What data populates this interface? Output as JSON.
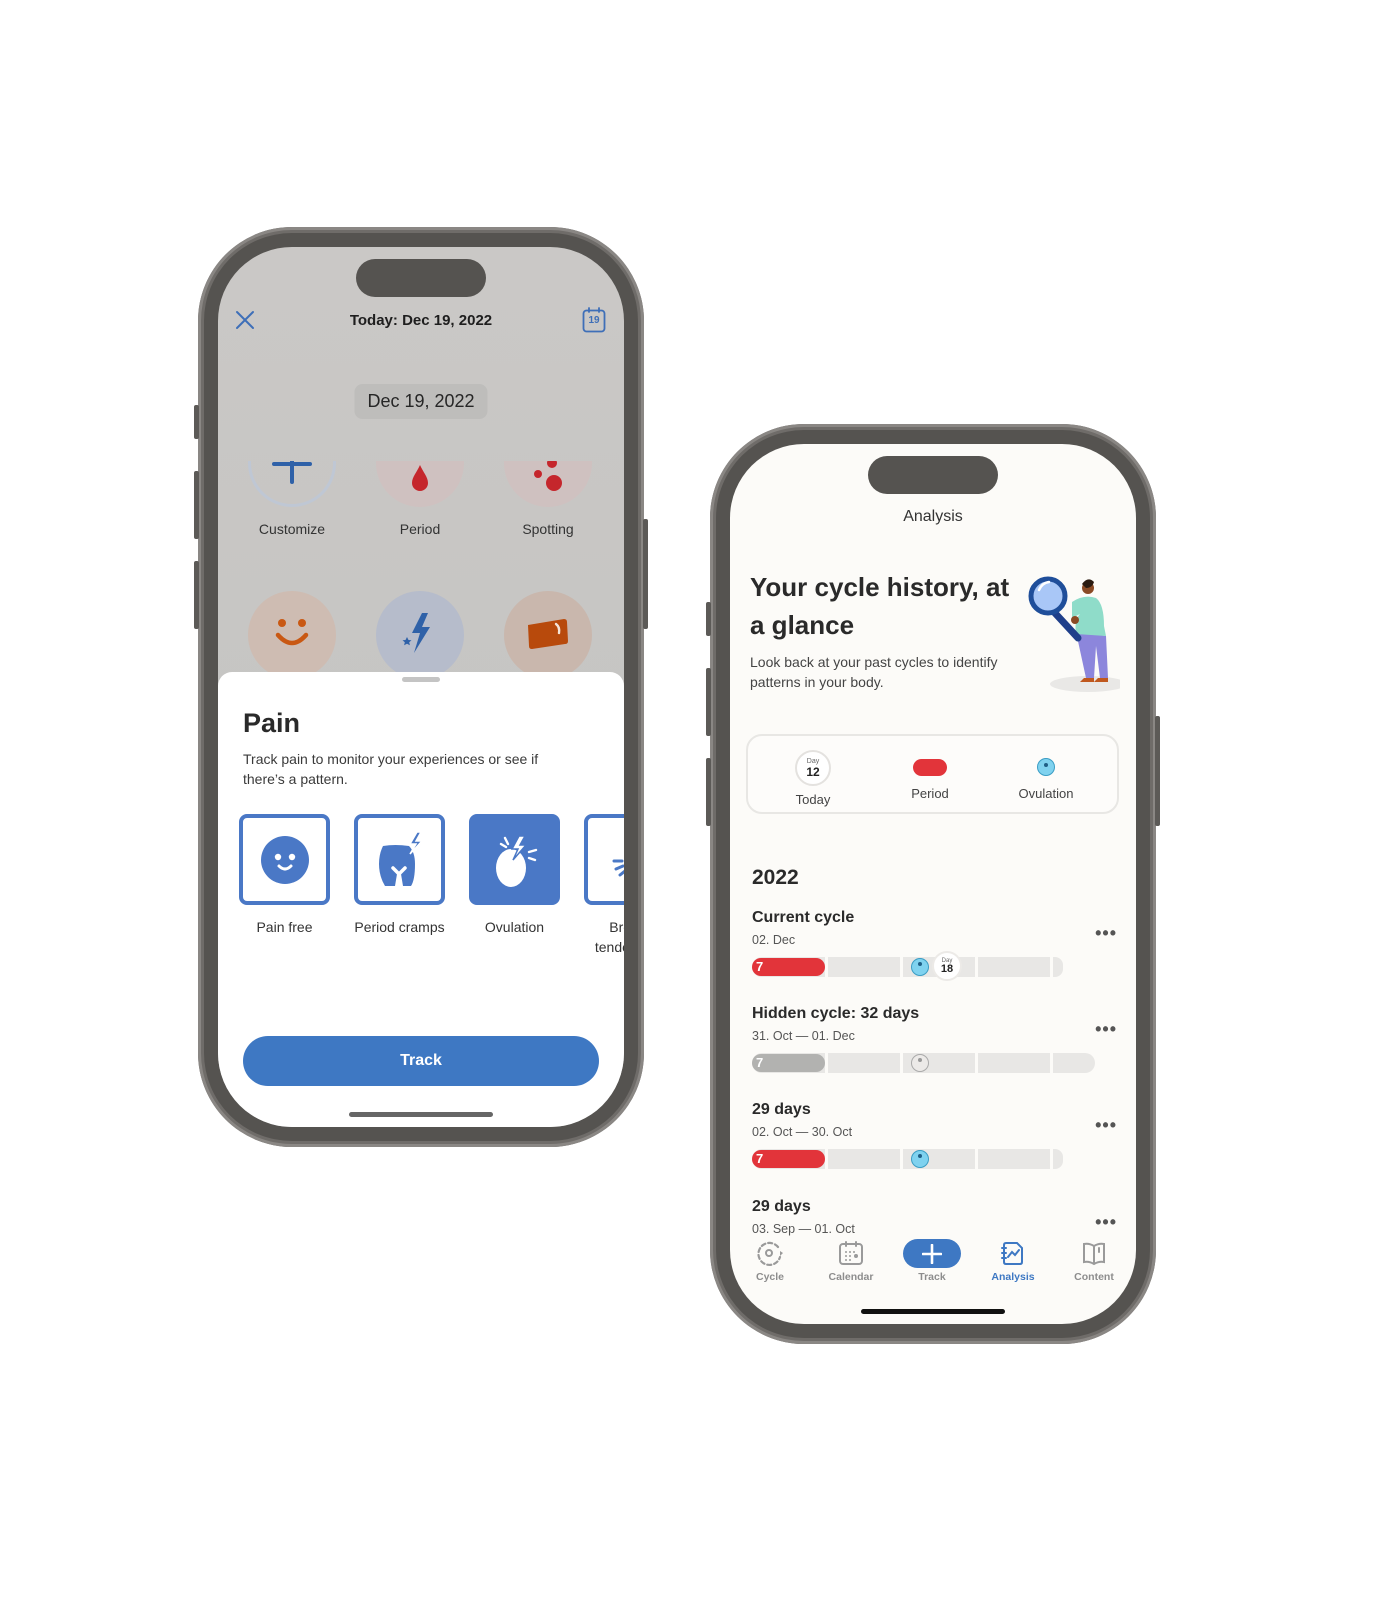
{
  "left_phone": {
    "header": {
      "title": "Today: Dec 19, 2022",
      "calendar_day": "19",
      "close_icon": "close-icon",
      "calendar_icon": "calendar-icon"
    },
    "date_pill": "Dec 19, 2022",
    "categories": [
      {
        "label": "Customize",
        "icon": "plus-icon"
      },
      {
        "label": "Period",
        "icon": "blood-drop-icon"
      },
      {
        "label": "Spotting",
        "icon": "spotting-dots-icon"
      },
      {
        "label": "",
        "icon": "smiley-face-icon"
      },
      {
        "label": "",
        "icon": "lightning-icon"
      },
      {
        "label": "",
        "icon": "pad-icon"
      }
    ],
    "sheet": {
      "title": "Pain",
      "description": "Track pain to monitor your experiences or see if there’s a pattern.",
      "options": [
        {
          "label": "Pain free",
          "icon": "smiley-face-icon",
          "selected": false
        },
        {
          "label": "Period cramps",
          "icon": "cramps-icon",
          "selected": false
        },
        {
          "label": "Ovulation",
          "icon": "ovulation-pain-icon",
          "selected": true
        },
        {
          "label": "Breast tenderness",
          "label_visible": "Br\ntend",
          "icon": "breast-tenderness-icon",
          "selected": false
        }
      ],
      "track_button": "Track"
    }
  },
  "right_phone": {
    "nav_title": "Analysis",
    "hero": {
      "title": "Your cycle history, at a glance",
      "description": "Look back at your past cycles to identify patterns in your body."
    },
    "legend": {
      "today": {
        "day_label": "Day",
        "day_number": "12",
        "label": "Today"
      },
      "period": {
        "label": "Period"
      },
      "ovulation": {
        "label": "Ovulation"
      }
    },
    "year": "2022",
    "cycles": [
      {
        "title": "Current cycle",
        "dates": "02. Dec",
        "period_days": "7",
        "hidden": false,
        "today_day_label": "Day",
        "today_day": "18",
        "more": "•••"
      },
      {
        "title": "Hidden cycle: 32 days",
        "dates": "31. Oct — 01. Dec",
        "period_days": "7",
        "hidden": true,
        "more": "•••"
      },
      {
        "title": "29 days",
        "dates": "02. Oct — 30. Oct",
        "period_days": "7",
        "hidden": false,
        "more": "•••"
      },
      {
        "title": "29 days",
        "dates": "03. Sep — 01. Oct",
        "more": "•••"
      }
    ],
    "tabs": [
      {
        "label": "Cycle",
        "icon": "cycle-icon",
        "active": false
      },
      {
        "label": "Calendar",
        "icon": "calendar-icon",
        "active": false
      },
      {
        "label": "Track",
        "icon": "plus-icon",
        "active": false
      },
      {
        "label": "Analysis",
        "icon": "analysis-icon",
        "active": true
      },
      {
        "label": "Content",
        "icon": "book-icon",
        "active": false
      }
    ]
  },
  "colors": {
    "primary_blue": "#3e78c3",
    "option_blue": "#4a78c6",
    "period_red": "#e2343a",
    "ovulation_cyan": "#7fd2ef",
    "hidden_gray": "#b2b2b0"
  }
}
